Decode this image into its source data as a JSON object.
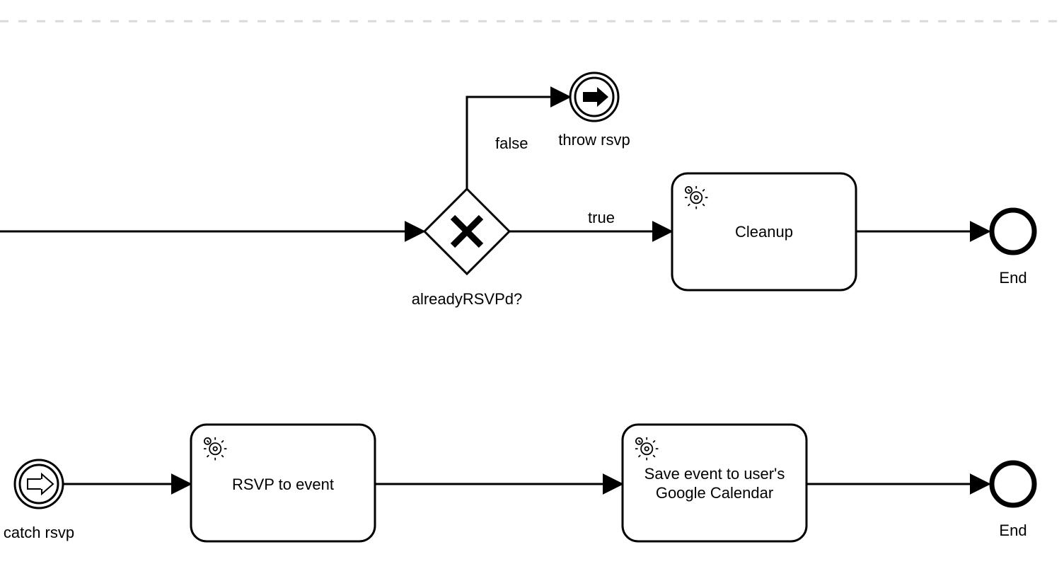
{
  "diagram": {
    "gateway": {
      "label": "alreadyRSVPd?"
    },
    "flows": {
      "false_label": "false",
      "true_label": "true"
    },
    "throw_event": {
      "label": "throw rsvp"
    },
    "task_cleanup": {
      "label": "Cleanup"
    },
    "end1": {
      "label": "End"
    },
    "catch_event": {
      "label": "catch rsvp"
    },
    "task_rsvp": {
      "label": "RSVP to event"
    },
    "task_save": {
      "label": "Save event to user's Google Calendar"
    },
    "end2": {
      "label": "End"
    }
  }
}
